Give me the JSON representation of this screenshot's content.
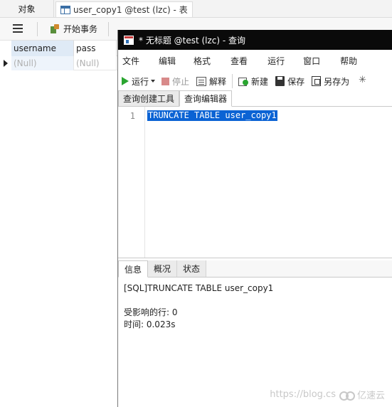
{
  "background": {
    "tabs": {
      "objects_label": "对象",
      "table_tab_label": "user_copy1 @test (lzc) - 表"
    },
    "toolbar": {
      "begin_transaction_label": "开始事务"
    },
    "grid": {
      "columns": [
        "username",
        "pass"
      ],
      "row": [
        "(Null)",
        "(Null)"
      ]
    }
  },
  "query_window": {
    "title": "* 无标题 @test (lzc) - 查询",
    "menu": [
      "文件",
      "编辑",
      "格式",
      "查看",
      "运行",
      "窗口",
      "帮助"
    ],
    "toolbar": {
      "run_label": "运行",
      "stop_label": "停止",
      "explain_label": "解释",
      "new_label": "新建",
      "save_label": "保存",
      "save_as_label": "另存为"
    },
    "tabs": {
      "builder_label": "查询创建工具",
      "editor_label": "查询编辑器",
      "active": "查询编辑器"
    },
    "editor": {
      "line_number": "1",
      "sql": "TRUNCATE TABLE user_copy1"
    },
    "result_tabs": {
      "info_label": "信息",
      "profile_label": "概况",
      "status_label": "状态",
      "active": "信息"
    },
    "output": {
      "sql_line": "[SQL]TRUNCATE TABLE user_copy1",
      "affected_rows": "受影响的行: 0",
      "time": "时间: 0.023s"
    }
  },
  "watermark": {
    "url_text": "https://blog.cs",
    "brand_text": "亿速云"
  },
  "colors": {
    "titlebar": "#0a0a0a",
    "selection": "#0b63d4",
    "run_green": "#2aa530",
    "header_highlight": "#dfeaf6"
  }
}
